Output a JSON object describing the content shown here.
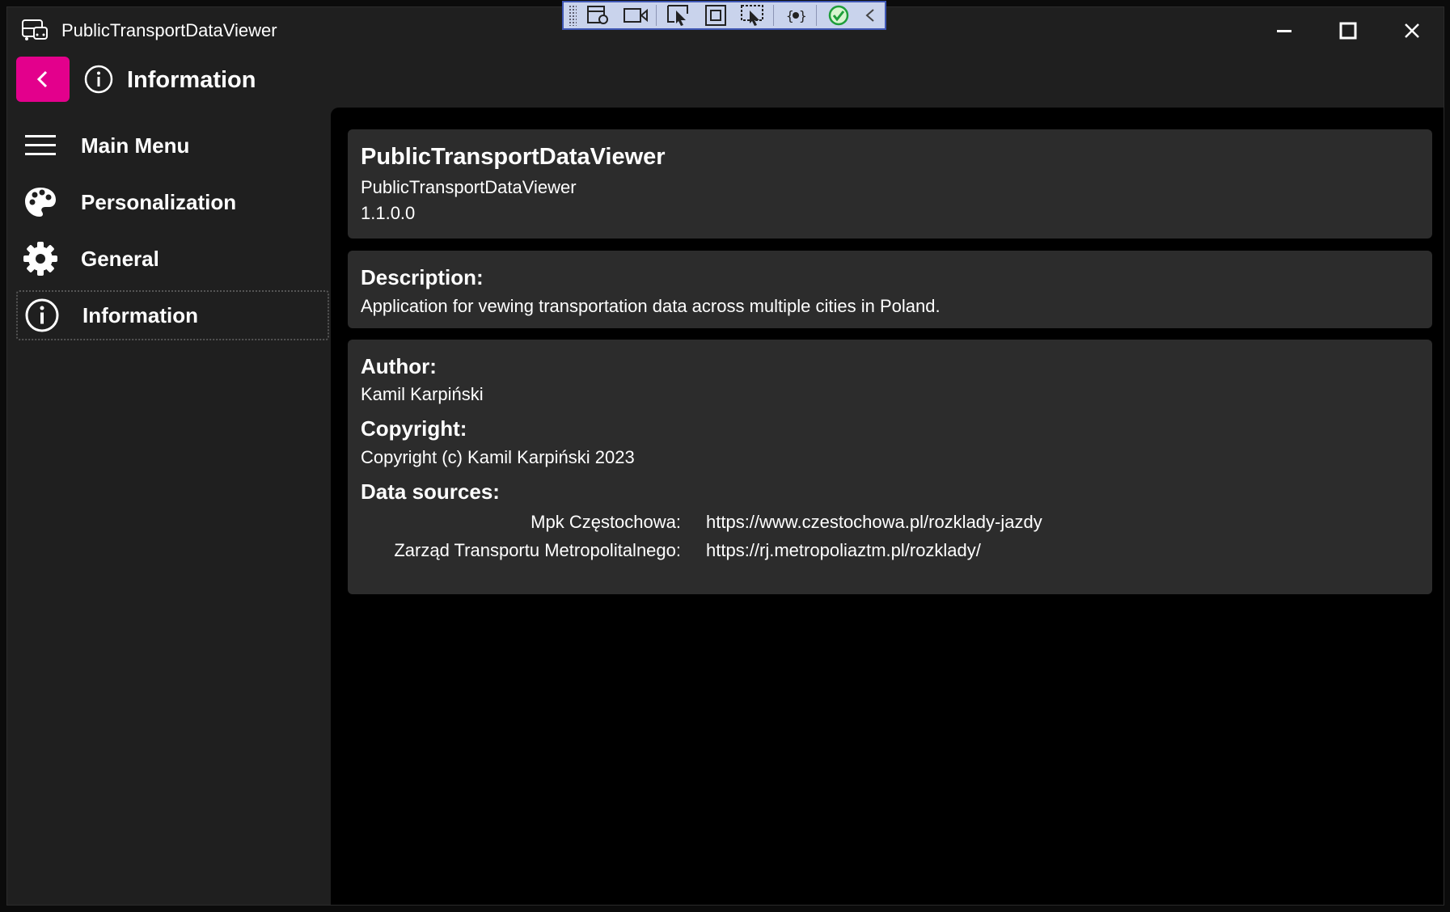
{
  "window": {
    "title": "PublicTransportDataViewer",
    "controls": [
      "minimize-icon",
      "maximize-icon",
      "close-icon"
    ]
  },
  "header": {
    "back_icon": "chevron-left-icon",
    "icon": "info-icon",
    "title": "Information",
    "accent_color": "#e3008c"
  },
  "sidebar": {
    "items": [
      {
        "label": "Main Menu",
        "icon": "hamburger-icon",
        "selected": false
      },
      {
        "label": "Personalization",
        "icon": "palette-icon",
        "selected": false
      },
      {
        "label": "General",
        "icon": "gear-icon",
        "selected": false
      },
      {
        "label": "Information",
        "icon": "info-icon",
        "selected": true
      }
    ]
  },
  "about": {
    "app_name": "PublicTransportDataViewer",
    "app_subtitle": "PublicTransportDataViewer",
    "version": "1.1.0.0",
    "description_title": "Description:",
    "description": "Application for vewing transportation data across multiple cities in Poland.",
    "author_title": "Author:",
    "author": "Kamil Karpiński",
    "copyright_title": "Copyright:",
    "copyright": "Copyright (c) Kamil Karpiński 2023",
    "sources_title": "Data sources:",
    "sources": [
      {
        "name": "Mpk Częstochowa:",
        "url": "https://www.czestochowa.pl/rozklady-jazdy"
      },
      {
        "name": "Zarząd Transportu Metropolitalnego:",
        "url": "https://rj.metropoliaztm.pl/rozklady/"
      }
    ]
  },
  "debug_toolbar": {
    "buttons": [
      "live-visual-tree-icon",
      "record-icon",
      "select-element-icon",
      "display-layout-adorners-icon",
      "track-focus-icon",
      "binding-failures-icon",
      "hot-reload-icon",
      "collapse-icon"
    ]
  }
}
